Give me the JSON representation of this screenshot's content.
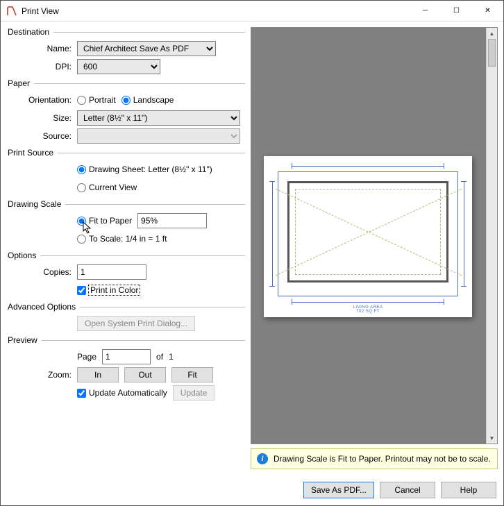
{
  "window": {
    "title": "Print View"
  },
  "destination": {
    "heading": "Destination",
    "name_label": "Name:",
    "name_value": "Chief Architect Save As PDF",
    "dpi_label": "DPI:",
    "dpi_value": "600"
  },
  "paper": {
    "heading": "Paper",
    "orientation_label": "Orientation:",
    "portrait": "Portrait",
    "landscape": "Landscape",
    "orientation_value": "landscape",
    "size_label": "Size:",
    "size_value": "Letter  (8½\" x 11\")",
    "source_label": "Source:",
    "source_value": ""
  },
  "print_source": {
    "heading": "Print Source",
    "drawing_sheet": "Drawing Sheet: Letter  (8½\" x 11\")",
    "current_view": "Current View",
    "selected": "drawing_sheet"
  },
  "drawing_scale": {
    "heading": "Drawing Scale",
    "fit_label": "Fit to Paper",
    "fit_value": "95%",
    "to_scale_label": "To Scale: 1/4 in = 1 ft",
    "selected": "fit"
  },
  "options": {
    "heading": "Options",
    "copies_label": "Copies:",
    "copies_value": "1",
    "print_in_color_label": "Print in Color",
    "print_in_color": true
  },
  "advanced": {
    "heading": "Advanced Options",
    "open_system_dialog": "Open System Print Dialog..."
  },
  "preview": {
    "heading": "Preview",
    "page_label": "Page",
    "page_value": "1",
    "of_label": "of",
    "page_count": "1",
    "zoom_label": "Zoom:",
    "zoom_in": "In",
    "zoom_out": "Out",
    "zoom_fit": "Fit",
    "update_auto_label": "Update Automatically",
    "update_auto": true,
    "update_btn": "Update",
    "page_caption_line1": "LIVING AREA",
    "page_caption_line2": "702 SQ FT"
  },
  "info": {
    "message": "Drawing Scale is Fit to Paper. Printout may not be to scale."
  },
  "footer": {
    "save": "Save As PDF...",
    "cancel": "Cancel",
    "help": "Help"
  }
}
